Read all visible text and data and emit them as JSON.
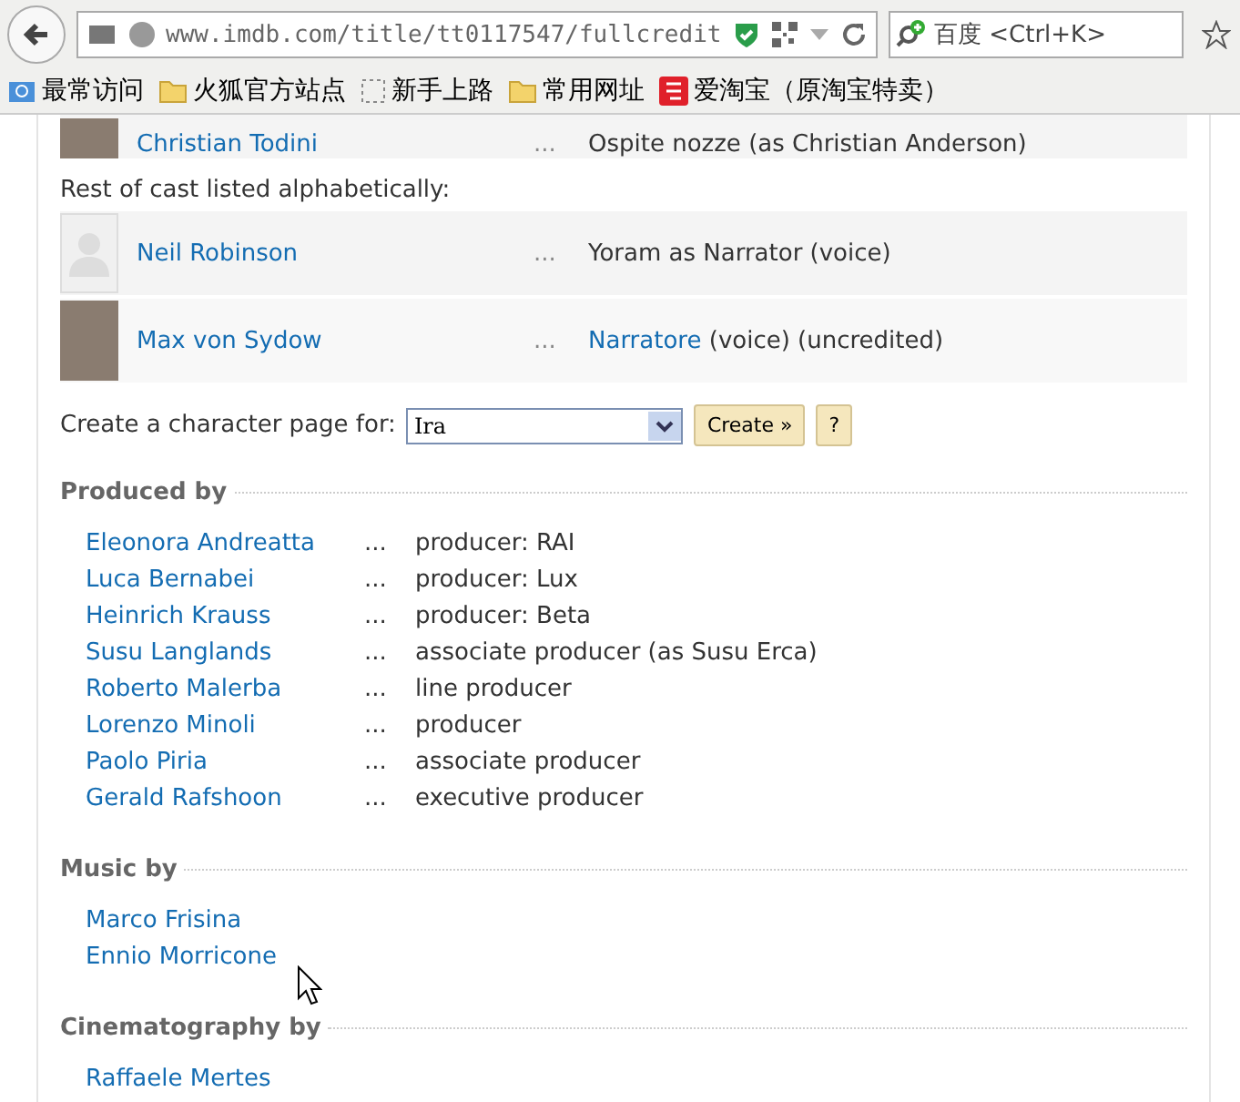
{
  "browser": {
    "url": "www.imdb.com/title/tt0117547/fullcredit",
    "search_placeholder": "百度 <Ctrl+K>"
  },
  "bookmarks": [
    {
      "label": "最常访问",
      "kind": "search"
    },
    {
      "label": "火狐官方站点",
      "kind": "folder"
    },
    {
      "label": "新手上路",
      "kind": "page"
    },
    {
      "label": "常用网址",
      "kind": "folder"
    },
    {
      "label": "爱淘宝（原淘宝特卖）",
      "kind": "taobao"
    }
  ],
  "cast_top": {
    "name": "Christian Todini",
    "dots": "...",
    "role": "Ospite nozze (as Christian Anderson)"
  },
  "rest_heading": "Rest of cast listed alphabetically:",
  "cast": [
    {
      "name": "Neil Robinson",
      "dots": "...",
      "role": "Yoram as Narrator (voice)",
      "photo": false
    },
    {
      "name": "Max von Sydow",
      "dots": "...",
      "role_link": "Narratore",
      "role": " (voice) (uncredited)",
      "photo": true
    }
  ],
  "character_page": {
    "label": "Create a character page for:",
    "value": "Ira",
    "create": "Create »",
    "help": "?"
  },
  "sections": [
    {
      "title": "Produced by",
      "credits": [
        {
          "name": "Eleonora Andreatta",
          "dots": "...",
          "role": "producer: RAI"
        },
        {
          "name": "Luca Bernabei",
          "dots": "...",
          "role": "producer: Lux"
        },
        {
          "name": "Heinrich Krauss",
          "dots": "...",
          "role": "producer: Beta"
        },
        {
          "name": "Susu Langlands",
          "dots": "...",
          "role": "associate producer (as Susu Erca)"
        },
        {
          "name": "Roberto Malerba",
          "dots": "...",
          "role": "line producer"
        },
        {
          "name": "Lorenzo Minoli",
          "dots": "...",
          "role": "producer"
        },
        {
          "name": "Paolo Piria",
          "dots": "...",
          "role": "associate producer"
        },
        {
          "name": "Gerald Rafshoon",
          "dots": "...",
          "role": "executive producer"
        }
      ]
    },
    {
      "title": "Music by",
      "credits": [
        {
          "name": "Marco Frisina"
        },
        {
          "name": "Ennio Morricone"
        }
      ]
    },
    {
      "title": "Cinematography by",
      "credits": [
        {
          "name": "Raffaele Mertes"
        }
      ]
    }
  ]
}
